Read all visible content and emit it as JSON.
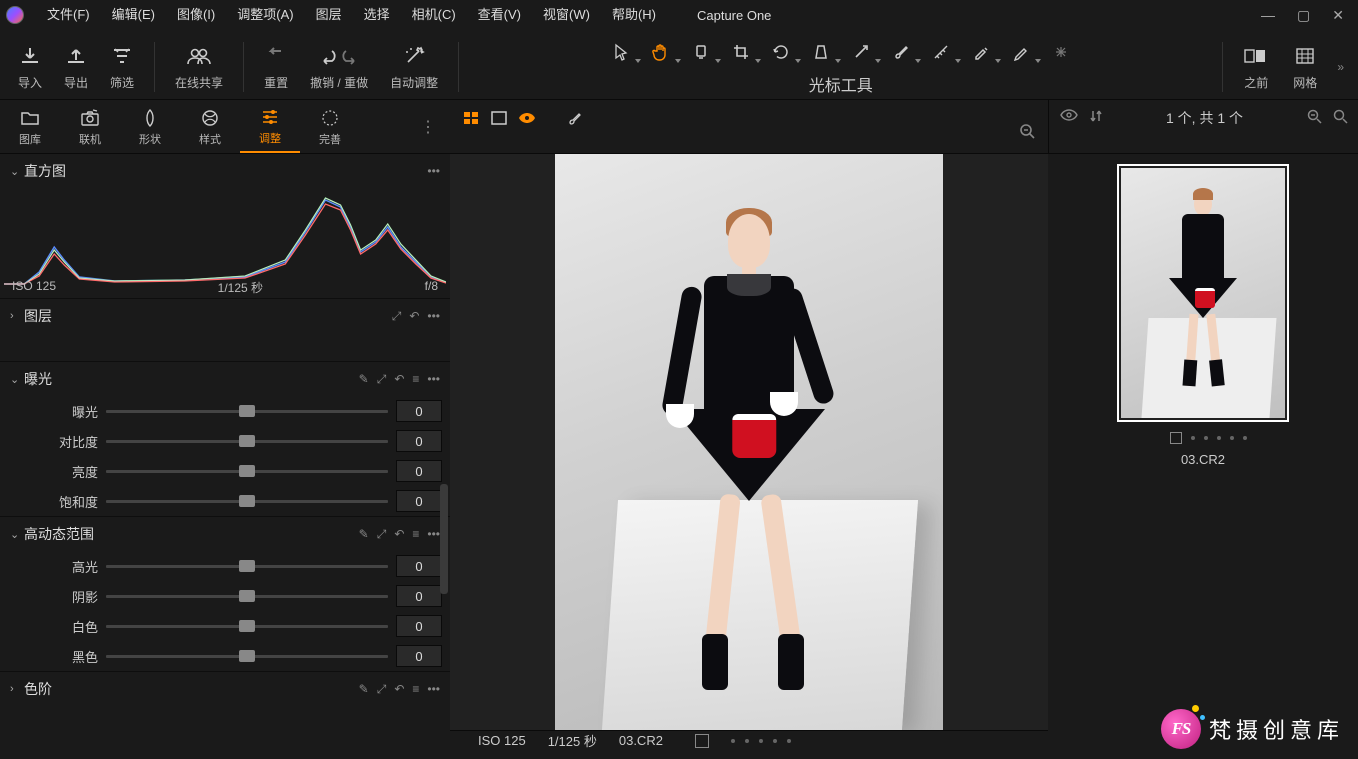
{
  "app_name": "Capture One",
  "menu": [
    "文件(F)",
    "编辑(E)",
    "图像(I)",
    "调整项(A)",
    "图层",
    "选择",
    "相机(C)",
    "查看(V)",
    "视窗(W)",
    "帮助(H)"
  ],
  "toolbar": {
    "import": "导入",
    "export": "导出",
    "filter": "筛选",
    "share": "在线共享",
    "reset": "重置",
    "undo_redo": "撤销 / 重做",
    "auto": "自动调整",
    "cursor_title": "光标工具",
    "before": "之前",
    "grid": "网格"
  },
  "tool_tabs": [
    {
      "label": "图库",
      "icon": "folder"
    },
    {
      "label": "联机",
      "icon": "camera"
    },
    {
      "label": "形状",
      "icon": "lens"
    },
    {
      "label": "样式",
      "icon": "styles"
    },
    {
      "label": "调整",
      "icon": "sliders",
      "active": true
    },
    {
      "label": "完善",
      "icon": "refine"
    }
  ],
  "panels": {
    "histogram": {
      "title": "直方图",
      "iso": "ISO 125",
      "shutter": "1/125 秒",
      "aperture": "f/8"
    },
    "layers": {
      "title": "图层"
    },
    "exposure": {
      "title": "曝光",
      "rows": [
        {
          "label": "曝光",
          "value": "0"
        },
        {
          "label": "对比度",
          "value": "0"
        },
        {
          "label": "亮度",
          "value": "0"
        },
        {
          "label": "饱和度",
          "value": "0"
        }
      ]
    },
    "hdr": {
      "title": "高动态范围",
      "rows": [
        {
          "label": "高光",
          "value": "0"
        },
        {
          "label": "阴影",
          "value": "0"
        },
        {
          "label": "白色",
          "value": "0"
        },
        {
          "label": "黑色",
          "value": "0"
        }
      ]
    },
    "levels": {
      "title": "色阶"
    }
  },
  "viewer_info": {
    "iso": "ISO 125",
    "shutter": "1/125 秒",
    "filename": "03.CR2"
  },
  "browser": {
    "count": "1 个, 共 1 个",
    "thumb_name": "03.CR2"
  },
  "watermark": "梵摄创意库"
}
